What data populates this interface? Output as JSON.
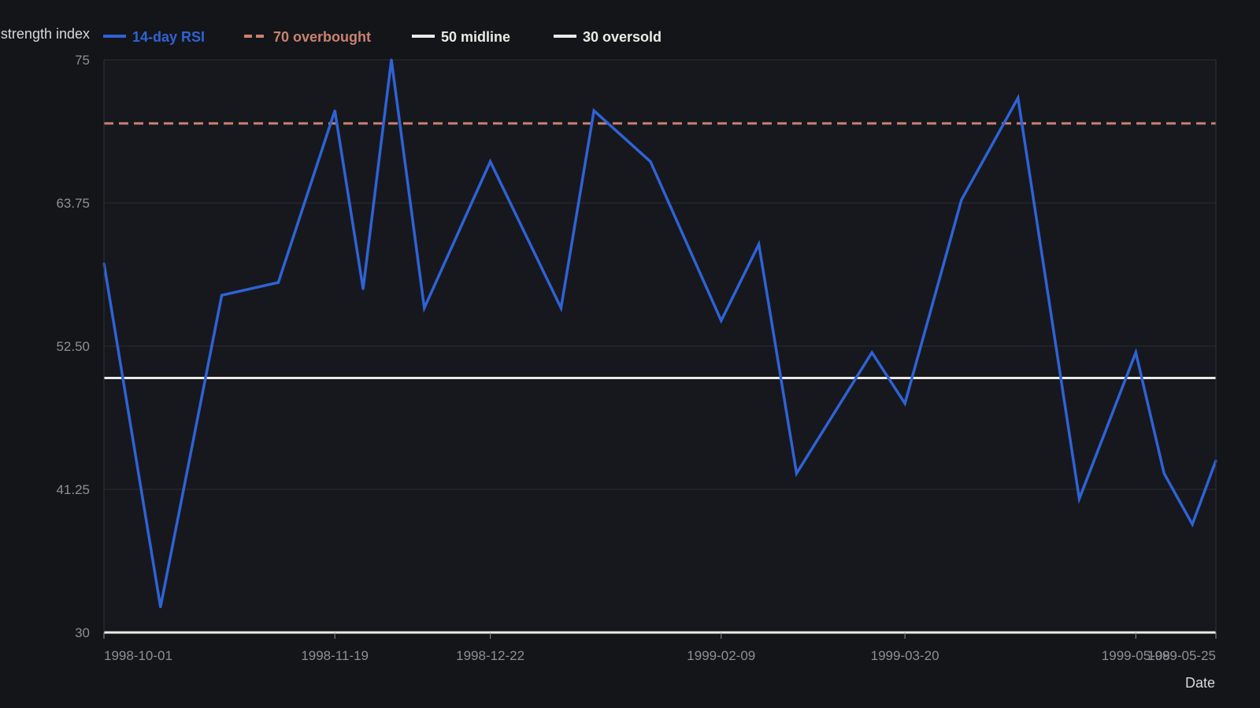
{
  "chart_data": {
    "type": "line",
    "title": "",
    "ylabel": "Relative strength index",
    "xlabel": "Date",
    "ylim": [
      30,
      75
    ],
    "yticks": [
      "75",
      "63.75",
      "52.50",
      "41.25",
      "30"
    ],
    "xticks": [
      "1998-10-01",
      "1998-11-19",
      "1998-12-22",
      "1999-02-09",
      "1999-03-20",
      "1999-05-08",
      "1999-05-25"
    ],
    "grid": true,
    "legend_position": "top",
    "series": [
      {
        "name": "14-day RSI",
        "color": "#2f62d6",
        "style": "solid",
        "x": [
          "1998-10-01",
          "1998-10-13",
          "1998-10-26",
          "1998-11-07",
          "1998-11-19",
          "1998-11-25",
          "1998-12-01",
          "1998-12-08",
          "1998-12-22",
          "1999-01-06",
          "1999-01-13",
          "1999-01-25",
          "1999-02-09",
          "1999-02-17",
          "1999-02-25",
          "1999-03-13",
          "1999-03-20",
          "1999-04-01",
          "1999-04-13",
          "1999-04-26",
          "1999-05-08",
          "1999-05-14",
          "1999-05-20",
          "1999-05-25"
        ],
        "values": [
          59.0,
          32.0,
          56.5,
          57.5,
          71.0,
          57.0,
          75.0,
          55.5,
          67.0,
          55.5,
          71.0,
          67.0,
          54.5,
          60.5,
          42.5,
          52.0,
          48.0,
          64.0,
          72.0,
          40.5,
          52.0,
          42.5,
          38.5,
          43.5
        ]
      },
      {
        "name": "70 overbought",
        "color": "#c9826f",
        "style": "dashed",
        "level": 70
      },
      {
        "name": "50 midline",
        "color": "#eceae4",
        "style": "solid",
        "level": 50
      },
      {
        "name": "30 oversold",
        "color": "#eceae4",
        "style": "solid",
        "level": 30
      }
    ]
  }
}
